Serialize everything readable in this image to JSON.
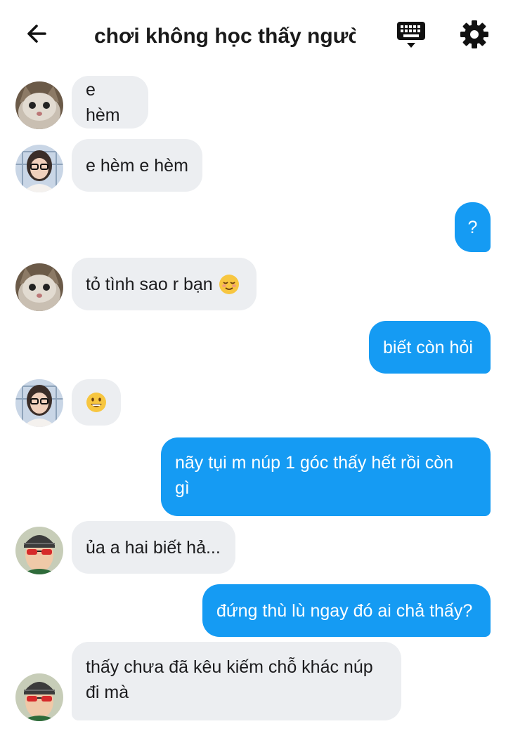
{
  "header": {
    "title": "chơi không học thấy ngườ⋯",
    "back_icon": "arrow-left-icon",
    "keyboard_icon": "keyboard-icon",
    "settings_icon": "gear-icon"
  },
  "messages": [
    {
      "sender": "other",
      "avatar": "cat-avatar",
      "text": "e hèm"
    },
    {
      "sender": "other",
      "avatar": "girl-glasses-avatar",
      "text": "e hèm e hèm"
    },
    {
      "sender": "me",
      "text": "?"
    },
    {
      "sender": "other",
      "avatar": "cat-avatar",
      "text": "tỏ tình sao r bạn",
      "emoji": "relieved-face-emoji"
    },
    {
      "sender": "me",
      "text": "biết còn hỏi"
    },
    {
      "sender": "other",
      "avatar": "girl-glasses-avatar",
      "text": "",
      "emoji": "grinning-face-emoji"
    },
    {
      "sender": "me",
      "text": "nãy tụi m núp 1 góc thấy hết rồi còn",
      "text_line2": "gì"
    },
    {
      "sender": "other",
      "avatar": "boy-red-glasses-avatar",
      "text": "ủa a hai biết hả..."
    },
    {
      "sender": "me",
      "text": "đứng thù lù ngay đó ai chả thấy?"
    },
    {
      "sender": "other",
      "avatar": "boy-red-glasses-avatar",
      "text": "thấy chưa đã kêu kiếm chỗ khác núp",
      "text_line2": "đi mà"
    }
  ],
  "colors": {
    "outgoing_bubble": "#159bf3",
    "incoming_bubble": "#eceef1",
    "background": "#ffffff"
  }
}
